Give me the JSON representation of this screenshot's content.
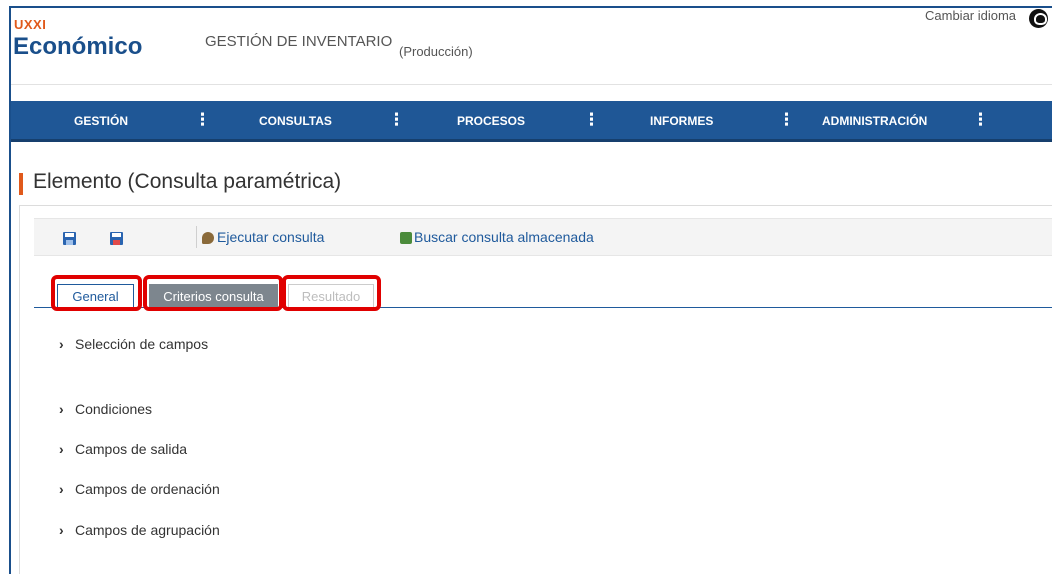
{
  "header": {
    "logo_small": "UXXI",
    "logo_big": "Económico",
    "app_title": "GESTIÓN DE INVENTARIO",
    "environment": "(Producción)",
    "language_link": "Cambiar idioma",
    "language_icon": "globe-icon"
  },
  "nav": {
    "items": [
      {
        "label": "GESTIÓN"
      },
      {
        "label": "CONSULTAS"
      },
      {
        "label": "PROCESOS"
      },
      {
        "label": "INFORMES"
      },
      {
        "label": "ADMINISTRACIÓN"
      }
    ],
    "menu_glyph": "⋮"
  },
  "page": {
    "title": "Elemento (Consulta paramétrica)"
  },
  "toolbar": {
    "save_icon": "save-icon",
    "save_as_icon": "save-as-icon",
    "run_query": "Ejecutar consulta",
    "find_saved_query": "Buscar consulta almacenada"
  },
  "tabs": [
    {
      "label": "General",
      "state": "active"
    },
    {
      "label": "Criterios consulta",
      "state": "selected-gray"
    },
    {
      "label": "Resultado",
      "state": "disabled"
    }
  ],
  "sections": [
    {
      "label": "Selección de campos"
    },
    {
      "label": "Condiciones"
    },
    {
      "label": "Campos de salida"
    },
    {
      "label": "Campos de ordenación"
    },
    {
      "label": "Campos de agrupación"
    }
  ],
  "colors": {
    "brand_blue": "#1f5796",
    "brand_orange": "#e0591b",
    "highlight_red": "#e00000",
    "tab_gray": "#7d868e"
  }
}
